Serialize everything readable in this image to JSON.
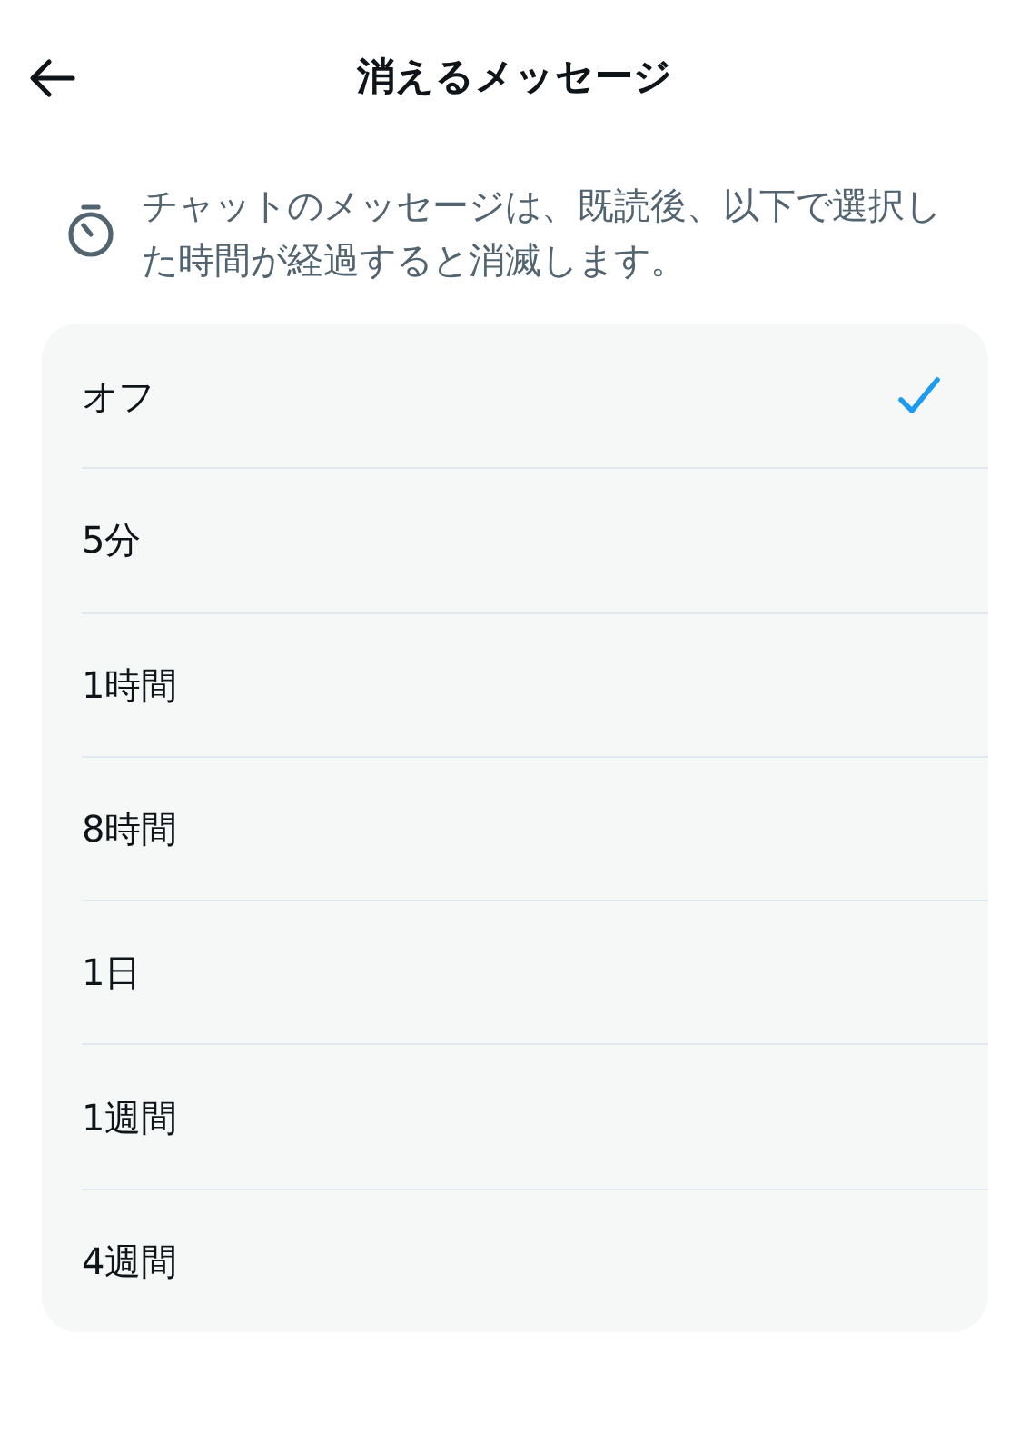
{
  "header": {
    "title": "消えるメッセージ"
  },
  "description": "チャットのメッセージは、既読後、以下で選択した時間が経過すると消滅します。",
  "options": [
    {
      "label": "オフ",
      "selected": true
    },
    {
      "label": "5分",
      "selected": false
    },
    {
      "label": "1時間",
      "selected": false
    },
    {
      "label": "8時間",
      "selected": false
    },
    {
      "label": "1日",
      "selected": false
    },
    {
      "label": "1週間",
      "selected": false
    },
    {
      "label": "4週間",
      "selected": false
    }
  ]
}
